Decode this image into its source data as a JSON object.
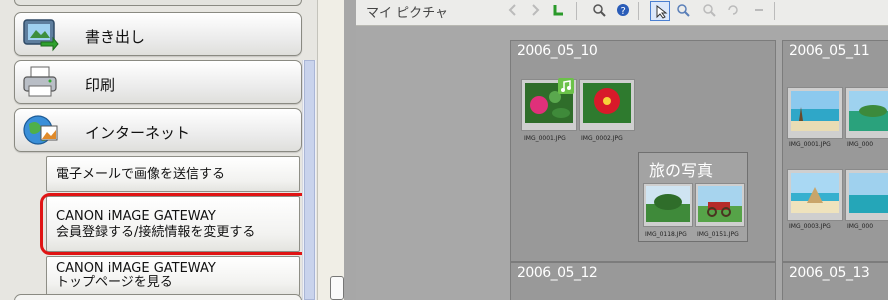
{
  "sidebar": {
    "buttons": [
      {
        "label": "書き出し",
        "icon": "export-icon"
      },
      {
        "label": "印刷",
        "icon": "printer-icon"
      },
      {
        "label": "インターネット",
        "icon": "globe-icon"
      }
    ],
    "sub_items": [
      {
        "line1": "電子メールで画像を送信する"
      },
      {
        "line1": "CANON iMAGE GATEWAY",
        "line2": "会員登録する/接続情報を変更する",
        "highlighted": true
      },
      {
        "line1": "CANON iMAGE GATEWAY",
        "line2": "トップページを見る"
      }
    ]
  },
  "viewer": {
    "folder_title": "マイ ピクチャ",
    "groups": [
      {
        "title": "2006_05_10",
        "files": [
          "IMG_0001.JPG",
          "IMG_0002.JPG"
        ]
      },
      {
        "title": "2006_05_11",
        "files": [
          "IMG_0001.JPG",
          "IMG_000",
          "IMG_0003.JPG",
          "IMG_000"
        ]
      },
      {
        "title": "2006_05_12",
        "files": []
      },
      {
        "title": "2006_05_13",
        "files": []
      }
    ],
    "album": {
      "title": "旅の写真",
      "files": [
        "IMG_0118.JPG",
        "IMG_0151.JPG"
      ]
    }
  },
  "colors": {
    "highlight": "#e01414",
    "panel_bg": "#a8a8a8"
  }
}
